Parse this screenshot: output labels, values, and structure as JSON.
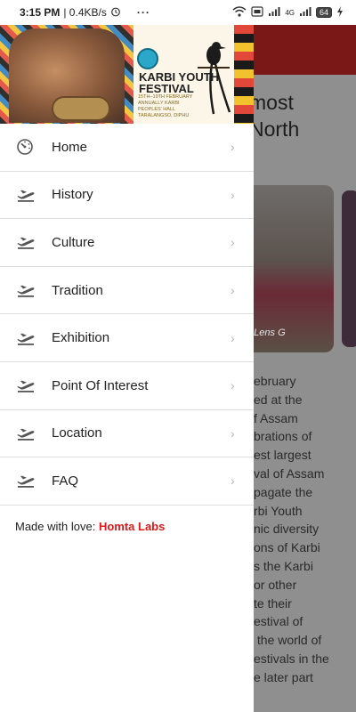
{
  "status_bar": {
    "time": "3:15 PM",
    "speed": "| 0.4KB/s",
    "overflow": "···",
    "network_4g": "4G",
    "battery": "64",
    "icons": [
      "alarm-icon",
      "wifi-icon",
      "volte-icon",
      "signal-icon",
      "charging-icon"
    ]
  },
  "banner": {
    "title": "KARBI YOUTH\nFESTIVAL",
    "info": "15TH–19TH FEBRUARY ANNUALLY KARBI PEOPLES' HALL TARALANGSO, DIPHU"
  },
  "menu": {
    "items": [
      {
        "label": "Home",
        "icon": "dashboard-icon"
      },
      {
        "label": "History",
        "icon": "flight-takeoff-icon"
      },
      {
        "label": "Culture",
        "icon": "flight-takeoff-icon"
      },
      {
        "label": "Tradition",
        "icon": "flight-takeoff-icon"
      },
      {
        "label": "Exhibition",
        "icon": "flight-takeoff-icon"
      },
      {
        "label": "Point Of Interest",
        "icon": "flight-takeoff-icon"
      },
      {
        "label": "Location",
        "icon": "flight-takeoff-icon"
      },
      {
        "label": "FAQ",
        "icon": "flight-takeoff-icon"
      }
    ]
  },
  "footer": {
    "prefix": "Made with love:",
    "brand": "Homta Labs"
  },
  "background_page": {
    "heading": "most\nNorth",
    "body": "ebruary\ned at the\nf Assam\nbrations of\nest largest\nval of Assam\npagate the\nrbi Youth\nnic diversity\nons of Karbi\ns the Karbi\nor other\nte their\nestival of\n the world of\nestivals in the\ne later part",
    "watermark": "e Lens G"
  },
  "colors": {
    "app_bar": "#7a1717",
    "brand_red": "#e01818",
    "scrim": "#8f8f8f"
  }
}
